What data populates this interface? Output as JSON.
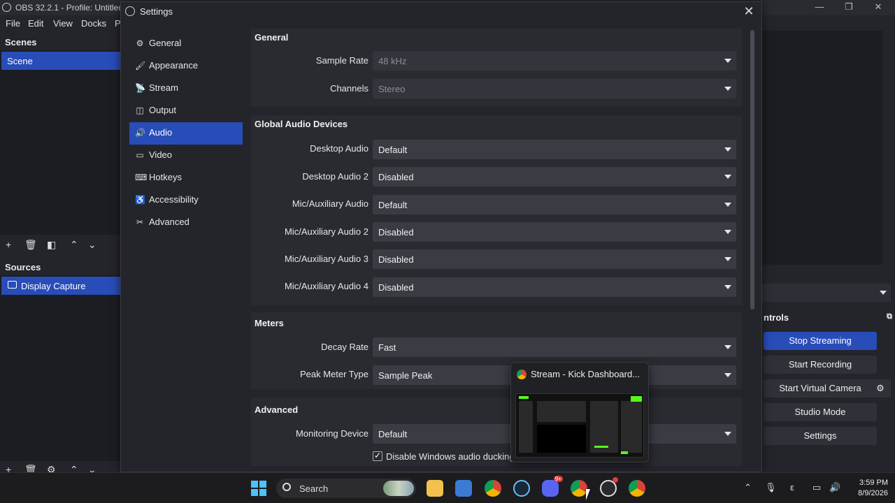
{
  "obs": {
    "title": "OBS 32.2.1 - Profile: Untitled -",
    "menu": [
      "File",
      "Edit",
      "View",
      "Docks",
      "P"
    ],
    "scenes_header": "Scenes",
    "scene_item": "Scene",
    "sources_header": "Sources",
    "source_item": "Display Capture",
    "controls_header": "ntrols",
    "controls": [
      "Stop Streaming",
      "Start Recording",
      "Start Virtual Camera",
      "Studio Mode",
      "Settings"
    ]
  },
  "settings": {
    "title": "Settings",
    "nav": [
      {
        "label": "General",
        "icon": "gear-icon"
      },
      {
        "label": "Appearance",
        "icon": "paint-icon"
      },
      {
        "label": "Stream",
        "icon": "antenna-icon"
      },
      {
        "label": "Output",
        "icon": "output-icon"
      },
      {
        "label": "Audio",
        "icon": "speaker-icon"
      },
      {
        "label": "Video",
        "icon": "monitor-icon"
      },
      {
        "label": "Hotkeys",
        "icon": "keyboard-icon"
      },
      {
        "label": "Accessibility",
        "icon": "accessibility-icon"
      },
      {
        "label": "Advanced",
        "icon": "wrench-icon"
      }
    ],
    "active_nav": "Audio",
    "general": {
      "title": "General",
      "sample_rate_label": "Sample Rate",
      "sample_rate_value": "48 kHz",
      "channels_label": "Channels",
      "channels_value": "Stereo"
    },
    "global_audio": {
      "title": "Global Audio Devices",
      "rows": [
        {
          "label": "Desktop Audio",
          "value": "Default"
        },
        {
          "label": "Desktop Audio 2",
          "value": "Disabled"
        },
        {
          "label": "Mic/Auxiliary Audio",
          "value": "Default"
        },
        {
          "label": "Mic/Auxiliary Audio 2",
          "value": "Disabled"
        },
        {
          "label": "Mic/Auxiliary Audio 3",
          "value": "Disabled"
        },
        {
          "label": "Mic/Auxiliary Audio 4",
          "value": "Disabled"
        }
      ]
    },
    "meters": {
      "title": "Meters",
      "decay_label": "Decay Rate",
      "decay_value": "Fast",
      "peak_label": "Peak Meter Type",
      "peak_value": "Sample Peak"
    },
    "advanced": {
      "title": "Advanced",
      "monitoring_label": "Monitoring Device",
      "monitoring_value": "Default",
      "ducking_label": "Disable Windows audio ducking"
    }
  },
  "taskbar": {
    "search_label": "Search",
    "time": "3:59 PM",
    "date": "8/9/2026",
    "discord_badge": "9+"
  },
  "preview": {
    "title": "Stream - Kick Dashboard..."
  }
}
